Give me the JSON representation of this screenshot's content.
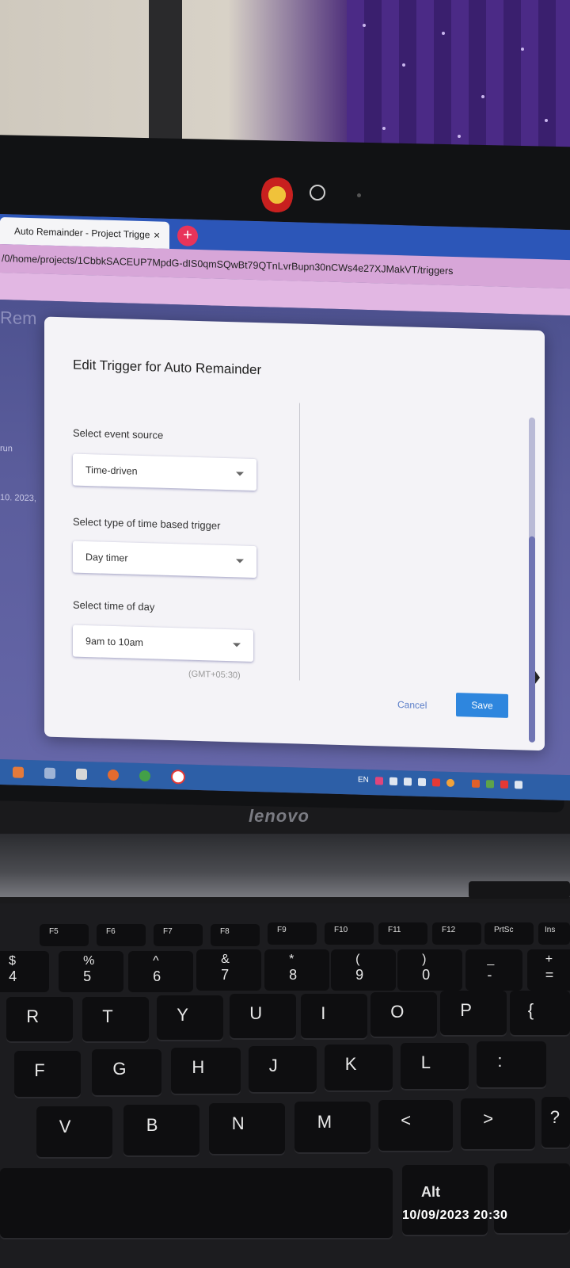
{
  "browser": {
    "tab_title": "Auto Remainder - Project Trigger",
    "tab_close": "×",
    "new_tab": "+",
    "url": "/0/home/projects/1CbbkSACEUP7MpdG-dIS0qmSQwBt79QTnLvrBupn30nCWs4e27XJMakVT/triggers"
  },
  "background_page": {
    "heading": "Rem",
    "run_fragment": "run",
    "date_fragment": "10. 2023,"
  },
  "dialog": {
    "title": "Edit Trigger for Auto Remainder",
    "event_source_label": "Select event source",
    "event_source_value": "Time-driven",
    "trigger_type_label": "Select type of time based trigger",
    "trigger_type_value": "Day timer",
    "time_of_day_label": "Select time of day",
    "time_of_day_value": "9am to 10am",
    "timezone": "(GMT+05:30)",
    "cancel_label": "Cancel",
    "save_label": "Save"
  },
  "taskbar": {
    "language": "EN"
  },
  "laptop": {
    "brand": "lenovo"
  },
  "keyboard": {
    "function_keys": [
      "F5",
      "F6",
      "F7",
      "F8",
      "F9",
      "F10",
      "F11",
      "F12",
      "PrtSc",
      "Ins"
    ],
    "number_row": [
      {
        "top": "$",
        "bottom": "4"
      },
      {
        "top": "%",
        "bottom": "5"
      },
      {
        "top": "^",
        "bottom": "6"
      },
      {
        "top": "&",
        "bottom": "7"
      },
      {
        "top": "*",
        "bottom": "8"
      },
      {
        "top": "(",
        "bottom": "9"
      },
      {
        "top": ")",
        "bottom": "0"
      },
      {
        "top": "_",
        "bottom": "-"
      },
      {
        "top": "+",
        "bottom": "="
      }
    ],
    "row_qwerty": [
      "R",
      "T",
      "Y",
      "U",
      "I",
      "O",
      "P",
      "{"
    ],
    "row_home": [
      "F",
      "G",
      "H",
      "J",
      "K",
      "L",
      ":"
    ],
    "row_bottom": [
      "V",
      "B",
      "N",
      "M",
      "<",
      ">",
      "?"
    ],
    "alt_label": "Alt"
  },
  "clock": {
    "date": "10/09/2023",
    "time": "20:30"
  },
  "colors": {
    "save_button": "#2e86de",
    "tab_bar": "#2c56b8",
    "address_bar": "#d7a6d8",
    "taskbar": "#2d5fa7"
  }
}
